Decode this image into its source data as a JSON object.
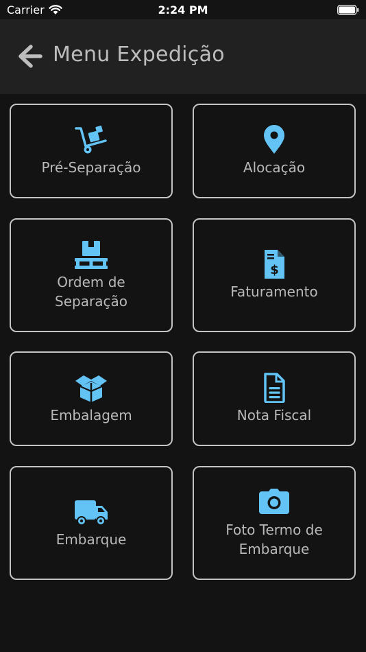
{
  "status": {
    "carrier": "Carrier",
    "time": "2:24 PM"
  },
  "header": {
    "title": "Menu Expedição"
  },
  "menu": {
    "items": [
      {
        "label": "Pré-Separação",
        "icon": "hand-truck-icon"
      },
      {
        "label": "Alocação",
        "icon": "map-pin-icon"
      },
      {
        "label": "Ordem de\nSeparação",
        "icon": "pallet-box-icon"
      },
      {
        "label": "Faturamento",
        "icon": "invoice-dollar-icon"
      },
      {
        "label": "Embalagem",
        "icon": "open-box-icon"
      },
      {
        "label": "Nota Fiscal",
        "icon": "document-icon"
      },
      {
        "label": "Embarque",
        "icon": "truck-icon"
      },
      {
        "label": "Foto Termo de\nEmbarque",
        "icon": "camera-icon"
      }
    ]
  },
  "colors": {
    "accent": "#63c3f5",
    "background": "#131313",
    "header": "#212121",
    "tile_border": "#c4c4c4"
  }
}
